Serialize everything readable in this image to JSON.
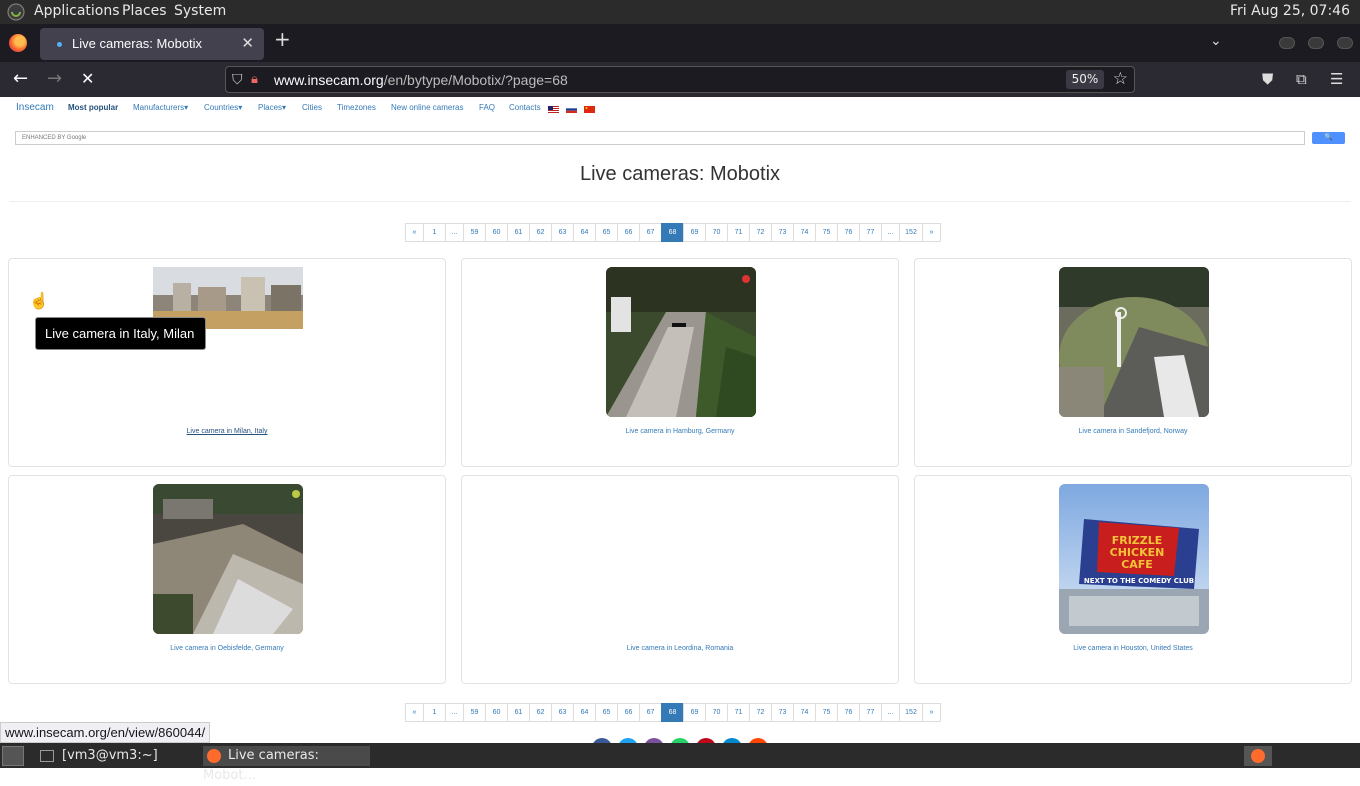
{
  "panel": {
    "applications": "Applications",
    "places": "Places",
    "system": "System",
    "clock": "Fri Aug 25, 07:46"
  },
  "browser": {
    "tab_title": "Live cameras: Mobotix",
    "url_host": "www.insecam.org",
    "url_path": "/en/bytype/Mobotix/?page=68",
    "zoom": "50%",
    "status_url": "www.insecam.org/en/view/860044/"
  },
  "site": {
    "brand": "Insecam",
    "nav": [
      "Most popular",
      "Manufacturers▾",
      "Countries▾",
      "Places▾",
      "Cities",
      "Timezones",
      "New online cameras",
      "FAQ",
      "Contacts"
    ],
    "search_label": "ENHANCED BY Google",
    "search_button": "🔍",
    "title": "Live cameras: Mobotix"
  },
  "pagination": {
    "items": [
      "«",
      "1",
      "...",
      "59",
      "60",
      "61",
      "62",
      "63",
      "64",
      "65",
      "66",
      "67",
      "68",
      "69",
      "70",
      "71",
      "72",
      "73",
      "74",
      "75",
      "76",
      "77",
      "...",
      "152",
      "»"
    ],
    "active": "68"
  },
  "cameras": [
    {
      "caption": "Live camera in Milan, Italy"
    },
    {
      "caption": "Live camera in Hamburg, Germany"
    },
    {
      "caption": "Live camera in Sandefjord, Norway"
    },
    {
      "caption": "Live camera in Oebisfelde, Germany"
    },
    {
      "caption": "Live camera in Leordina, Romania"
    },
    {
      "caption": "Live camera in Houston, United States"
    }
  ],
  "tooltip": "Live camera in Italy, Milan",
  "billboard": {
    "line1": "FRIZZLE",
    "line2": "CHICKEN",
    "line3": "CAFE",
    "line4": "NEXT TO THE COMEDY CLUB"
  },
  "taskbar": {
    "terminal": "[vm3@vm3:~]",
    "firefox": "Live cameras: Mobot..."
  }
}
